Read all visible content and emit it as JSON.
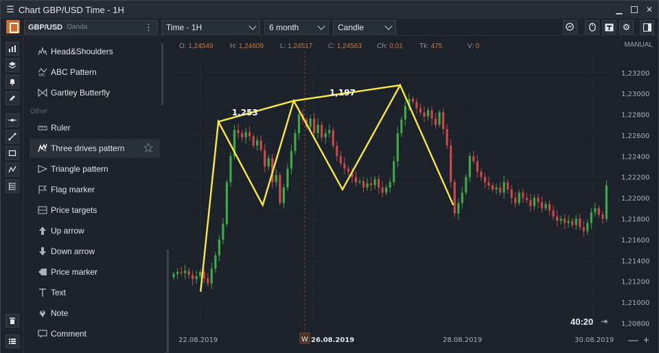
{
  "title": "Chart GBP/USD Time - 1H",
  "toolbar": {
    "symbol": "GBP/USD",
    "broker": "Oanda",
    "timeframe": "Time - 1H",
    "period": "6 month",
    "chart_type": "Candle"
  },
  "panel": {
    "top_items": [
      {
        "label": "Head&Shoulders",
        "icon": "head-shoulders-icon"
      },
      {
        "label": "ABC Pattern",
        "icon": "abc-pattern-icon"
      },
      {
        "label": "Gartley Butterfly",
        "icon": "gartley-icon"
      }
    ],
    "section": "Other",
    "other_items": [
      {
        "label": "Ruler",
        "icon": "ruler-icon"
      },
      {
        "label": "Three drives pattern",
        "icon": "three-drives-icon",
        "active": true
      },
      {
        "label": "Triangle pattern",
        "icon": "triangle-icon"
      },
      {
        "label": "Flag marker",
        "icon": "flag-icon"
      },
      {
        "label": "Price targets",
        "icon": "price-targets-icon"
      },
      {
        "label": "Up arrow",
        "icon": "up-arrow-icon"
      },
      {
        "label": "Down arrow",
        "icon": "down-arrow-icon"
      },
      {
        "label": "Price marker",
        "icon": "price-marker-icon"
      },
      {
        "label": "Text",
        "icon": "text-icon"
      },
      {
        "label": "Note",
        "icon": "note-icon"
      },
      {
        "label": "Comment",
        "icon": "comment-icon"
      }
    ]
  },
  "ohlc": {
    "o_label": "O:",
    "o": "1,24549",
    "h_label": "H:",
    "h": "1,24609",
    "l_label": "L:",
    "l": "1,24517",
    "c_label": "C:",
    "c": "1,24563",
    "ch_label": "Ch:",
    "ch": "0,01",
    "tk_label": "Tk:",
    "tk": "475",
    "v_label": "V:",
    "v": "0"
  },
  "mode": "MANUAL",
  "timer": "40:20",
  "colors": {
    "up": "#3fa94a",
    "down": "#c94a4a",
    "pattern": "#ffeb3b",
    "accent": "#d06c2b"
  },
  "chart_data": {
    "type": "candlestick",
    "y_ticks": [
      "1,23200",
      "1,23000",
      "1,22800",
      "1,22600",
      "1,22400",
      "1,22200",
      "1,22000",
      "1,21800",
      "1,21600",
      "1,21400",
      "1,21200",
      "1,21000",
      "1,20800"
    ],
    "x_ticks": [
      "22.08.2019",
      "26.08.2019",
      "28.08.2019",
      "30.08.2019"
    ],
    "week_marker": "W",
    "ylim": [
      1.2075,
      1.2335
    ],
    "pattern": {
      "name": "Three drives pattern",
      "points": [
        [
          0.07,
          1.211
        ],
        [
          0.11,
          1.2273
        ],
        [
          0.21,
          1.2193
        ],
        [
          0.28,
          1.2293
        ],
        [
          0.39,
          1.2208
        ],
        [
          0.52,
          1.2308
        ],
        [
          0.64,
          1.2193
        ]
      ],
      "labels": [
        {
          "text": "1,253",
          "x": 0.17,
          "y": 1.2279
        },
        {
          "text": "1,197",
          "x": 0.39,
          "y": 1.2298
        }
      ]
    },
    "candles_close": [
      1.2127,
      1.2129,
      1.2128,
      1.213,
      1.2126,
      1.2122,
      1.2125,
      1.2129,
      1.2123,
      1.2118,
      1.2132,
      1.2145,
      1.216,
      1.2175,
      1.2215,
      1.224,
      1.2265,
      1.2262,
      1.2258,
      1.2263,
      1.2259,
      1.225,
      1.2255,
      1.2246,
      1.223,
      1.2238,
      1.2215,
      1.2222,
      1.2195,
      1.221,
      1.2228,
      1.2245,
      1.2262,
      1.228,
      1.2275,
      1.2268,
      1.2276,
      1.2262,
      1.227,
      1.2258,
      1.2262,
      1.2265,
      1.225,
      1.224,
      1.2233,
      1.2228,
      1.2225,
      1.222,
      1.2215,
      1.2216,
      1.221,
      1.2214,
      1.2212,
      1.2218,
      1.221,
      1.2205,
      1.221,
      1.2215,
      1.2235,
      1.2262,
      1.2275,
      1.2288,
      1.2295,
      1.2292,
      1.2286,
      1.2282,
      1.2278,
      1.2284,
      1.2276,
      1.227,
      1.2282,
      1.2266,
      1.225,
      1.2215,
      1.2185,
      1.2195,
      1.2205,
      1.222,
      1.224,
      1.2235,
      1.2225,
      1.222,
      1.2215,
      1.2212,
      1.2208,
      1.221,
      1.2205,
      1.2215,
      1.2208,
      1.22,
      1.2195,
      1.2205,
      1.22,
      1.2198,
      1.2192,
      1.22,
      1.2196,
      1.219,
      1.2194,
      1.2188,
      1.2182,
      1.2178,
      1.218,
      1.2176,
      1.2178,
      1.2174,
      1.218,
      1.2172,
      1.2168,
      1.2176,
      1.2186,
      1.219,
      1.2184,
      1.218,
      1.2212
    ]
  }
}
